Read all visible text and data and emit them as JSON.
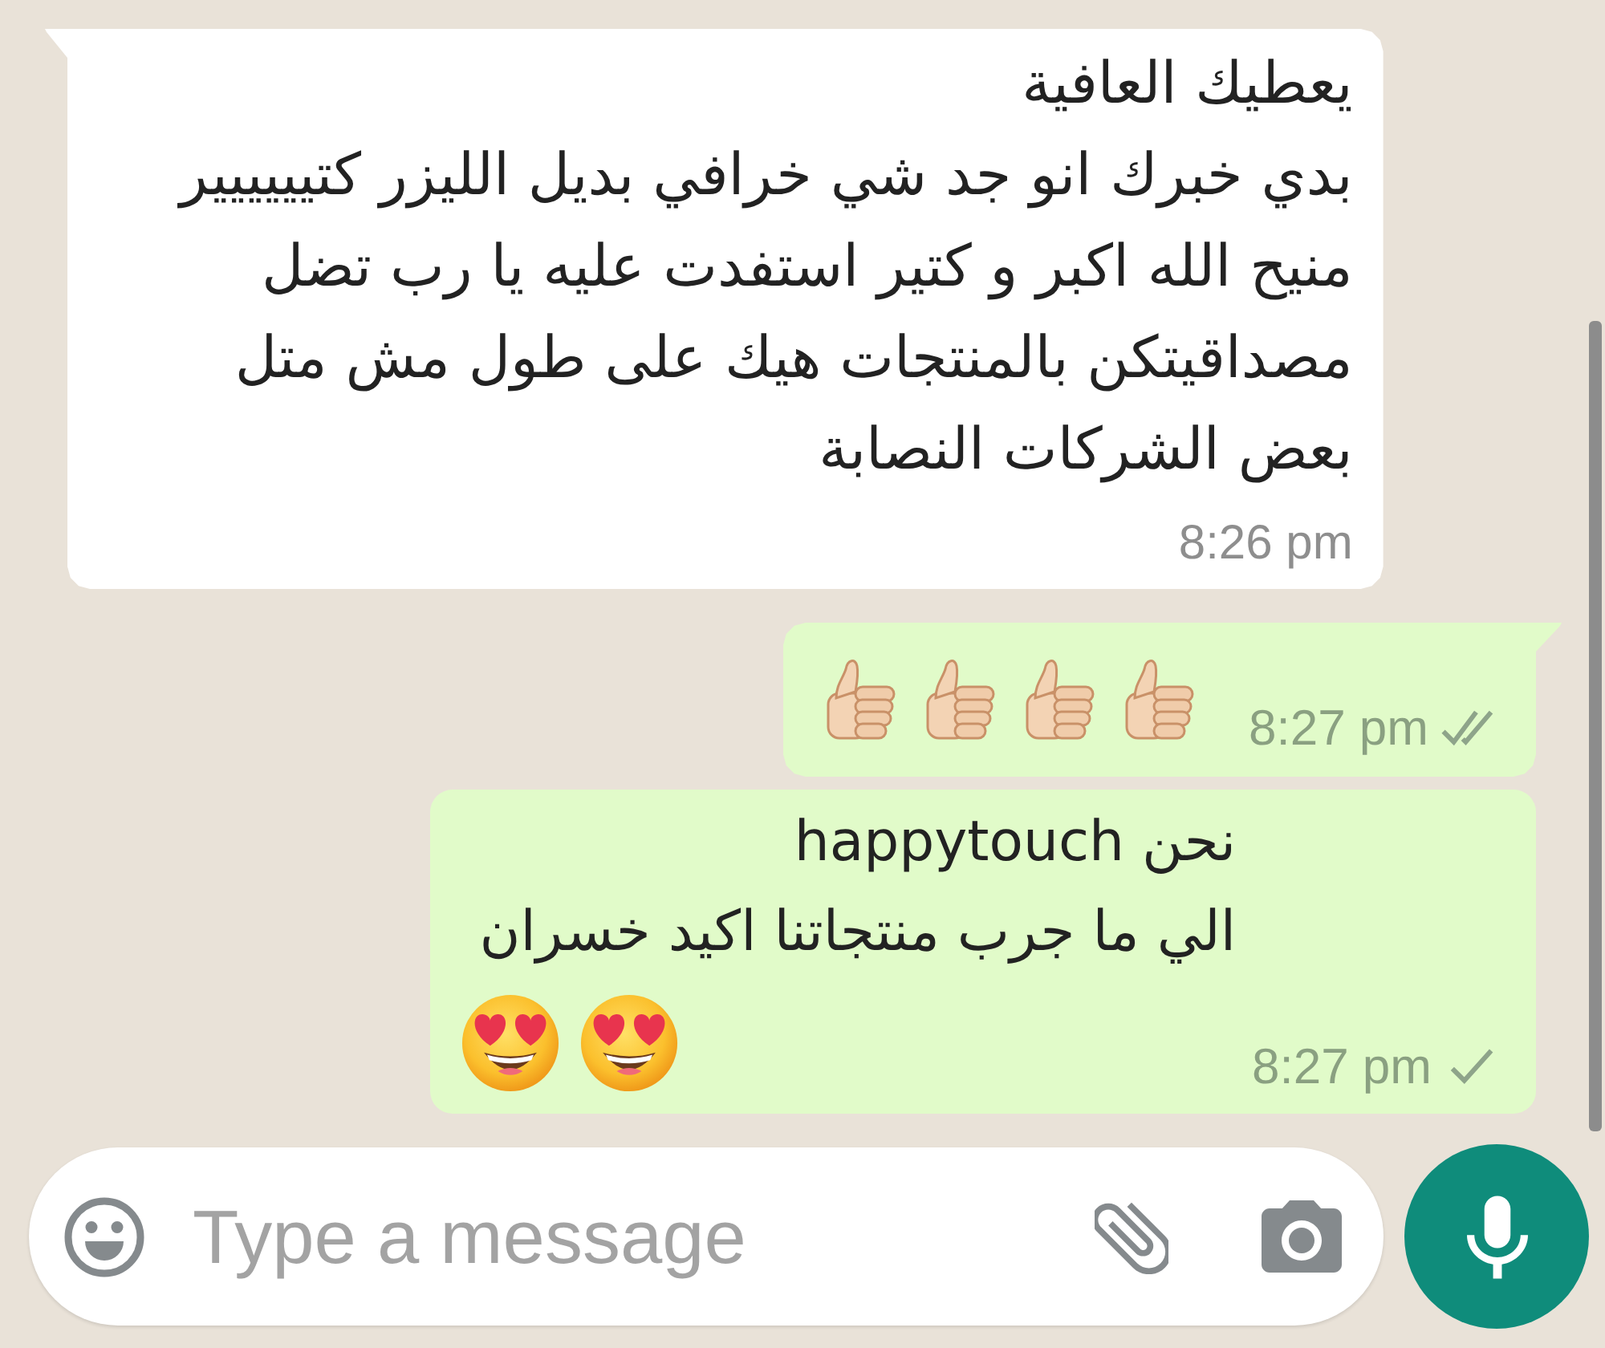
{
  "messages": [
    {
      "kind": "incoming",
      "tail": true,
      "text": "يعطيك العافية\nبدي خبرك انو جد شي خرافي بديل الليزر كتيييييير\nمنيح الله اكبر و كتير استفدت عليه يا رب تضل\nمصداقيتكن بالمنتجات هيك على طول مش متل\nبعض الشركات النصابة",
      "time": "8:26 pm"
    },
    {
      "kind": "outgoing",
      "tail": true,
      "emoji": [
        {
          "kind": "thumbs-up"
        },
        {
          "kind": "thumbs-up"
        },
        {
          "kind": "thumbs-up"
        },
        {
          "kind": "thumbs-up"
        }
      ],
      "time": "8:27 pm",
      "sent": true,
      "delivered": true
    },
    {
      "kind": "outgoing",
      "tail": false,
      "text": "نحن happytouch\nالي ما جرب منتجاتنا اكيد خسران",
      "emoji": [
        {
          "kind": "heart-eyes"
        },
        {
          "kind": "heart-eyes"
        }
      ],
      "time": "8:27 pm",
      "sent": true,
      "delivered": false
    }
  ],
  "composer": {
    "placeholder": "Type a message"
  }
}
